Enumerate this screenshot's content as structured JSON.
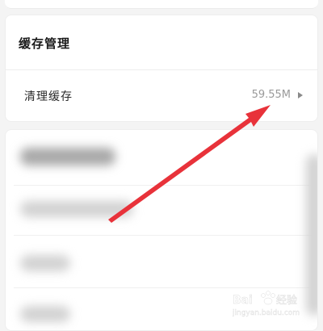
{
  "cache_section": {
    "title": "缓存管理",
    "clear_cache": {
      "label": "清理缓存",
      "value": "59.55M"
    }
  },
  "icons": {
    "row_chevron": "chevron-right-icon",
    "annotation": "red-arrow-icon"
  },
  "colors": {
    "annotation_arrow": "#e8323a",
    "page_background": "#f4f4f4",
    "card_background": "#ffffff",
    "value_text": "#9a9a9a"
  },
  "watermark": {
    "brand": "Baidu",
    "sub": "jingyan.baidu.com"
  }
}
